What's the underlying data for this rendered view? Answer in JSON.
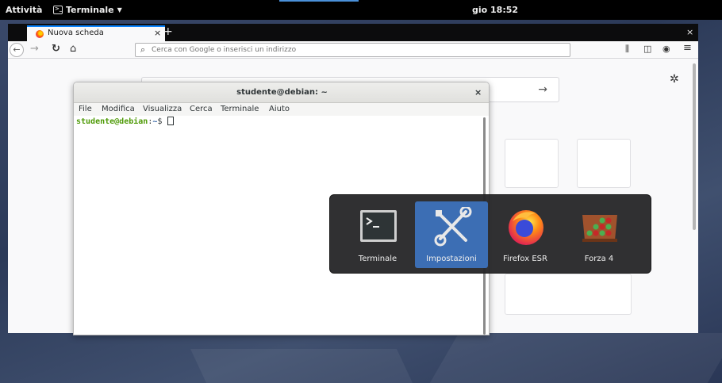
{
  "topbar": {
    "activities": "Attività",
    "app_menu": "Terminale",
    "clock": "gio 18:52"
  },
  "firefox": {
    "tab_title": "Nuova scheda",
    "tab_close": "×",
    "new_tab": "+",
    "window_close": "×",
    "url_placeholder": "Cerca con Google o inserisci un indirizzo",
    "search_go": "→"
  },
  "terminal": {
    "title": "studente@debian: ~",
    "close": "×",
    "menu": [
      "File",
      "Modifica",
      "Visualizza",
      "Cerca",
      "Terminale",
      "Aiuto"
    ],
    "prompt_user": "studente@debian",
    "prompt_sep": ":",
    "prompt_path": "~",
    "prompt_symbol": "$ "
  },
  "switcher": {
    "apps": [
      {
        "label": "Terminale",
        "icon": "terminal-icon",
        "selected": false
      },
      {
        "label": "Impostazioni",
        "icon": "settings-tools-icon",
        "selected": true
      },
      {
        "label": "Firefox ESR",
        "icon": "firefox-icon",
        "selected": false
      },
      {
        "label": "Forza 4",
        "icon": "four-in-a-row-icon",
        "selected": false
      }
    ]
  },
  "colors": {
    "selected_app": "#3c6eb4",
    "prompt_user": "#4e9a06",
    "prompt_path": "#3465a4",
    "firefox_accent": "#0a84ff"
  }
}
